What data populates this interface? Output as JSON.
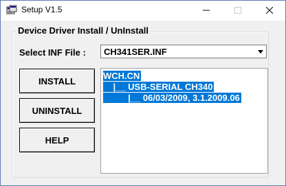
{
  "window": {
    "title": "Setup V1.5",
    "app_icon": "setup-app-icon",
    "controls": [
      "minimize-icon",
      "maximize-icon",
      "close-icon"
    ]
  },
  "group": {
    "label": "Device Driver Install / UnInstall"
  },
  "inf": {
    "label": "Select INF File :",
    "selected": "CH341SER.INF"
  },
  "buttons": {
    "install": "INSTALL",
    "uninstall": "UNINSTALL",
    "help": "HELP"
  },
  "driver_info": {
    "lines": [
      "WCH.CN",
      "    |__ USB-SERIAL CH340",
      "          |__ 06/03/2009, 3.1.2009.06"
    ]
  },
  "colors": {
    "selection": "#0078d7",
    "window_bg": "#f0f0f0"
  }
}
